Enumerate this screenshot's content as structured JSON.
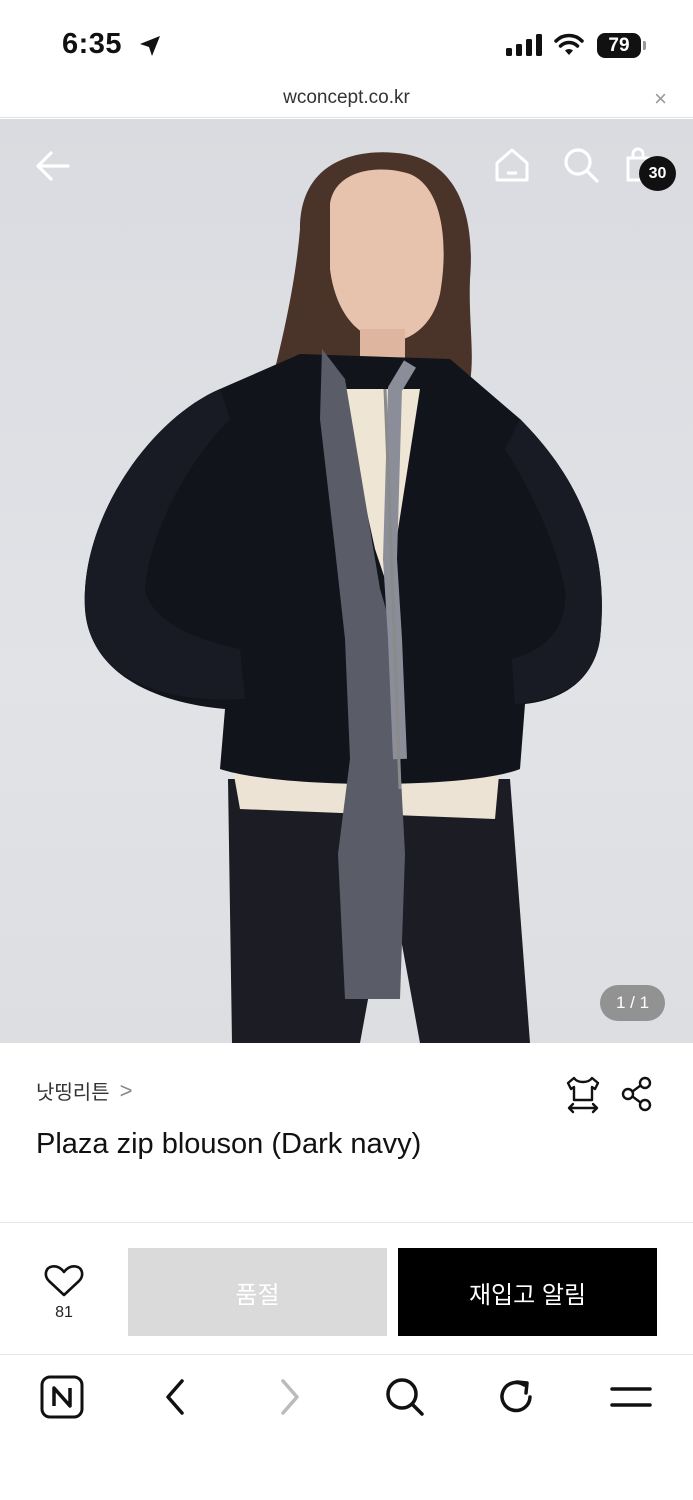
{
  "status_bar": {
    "time": "6:35",
    "battery": "79"
  },
  "browser": {
    "url": "wconcept.co.kr",
    "close_glyph": "×"
  },
  "hero": {
    "cart_count": "30",
    "image_counter": "1 / 1",
    "icons": [
      "back-arrow-icon",
      "home-icon",
      "search-icon",
      "shopping-bag-icon"
    ]
  },
  "product": {
    "brand": "낫띵리튼",
    "brand_chevron": ">",
    "title": "Plaza zip blouson (Dark navy)"
  },
  "actions": {
    "wishlist_count": "81",
    "soldout_label": "품절",
    "restock_label": "재입고 알림"
  },
  "toolbar": {
    "icons": [
      "naver-n-icon",
      "back-chevron-icon",
      "forward-chevron-icon",
      "search-icon",
      "refresh-icon",
      "menu-icon"
    ]
  },
  "colors": {
    "accent": "#000000",
    "soldout_bg": "#dadada",
    "badge_bg": "#111111",
    "counter_bg": "#7a7a7a"
  }
}
